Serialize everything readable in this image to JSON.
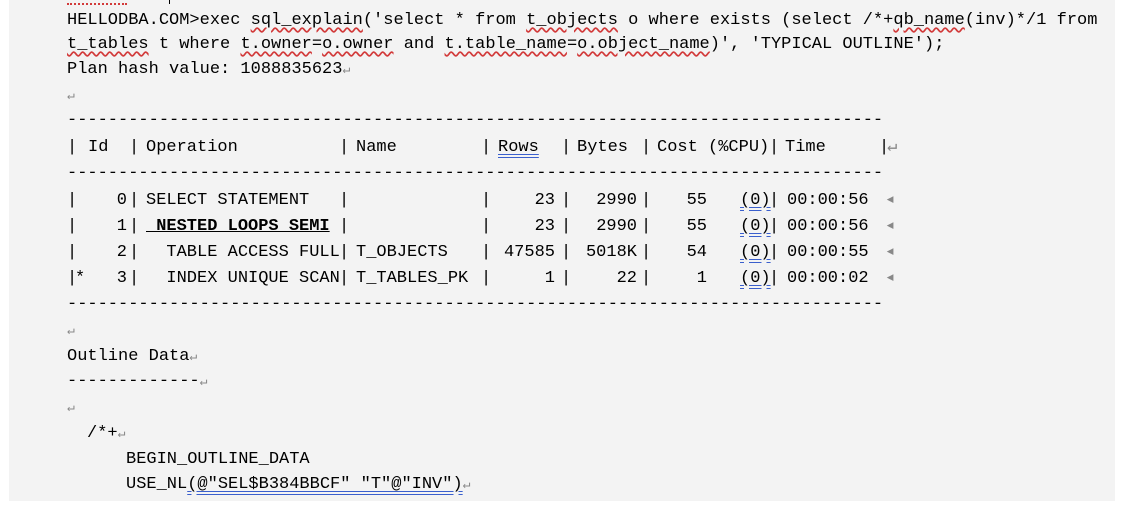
{
  "command": {
    "prompt": "HELLODBA.COM>",
    "line1_pre": "exec ",
    "line1_fn": "sql_explain",
    "line1_open": "('select * from ",
    "line1_obj": "t_objects",
    "line1_mid": " o where exists (select /*+",
    "line1_qb": "qb_name",
    "line1_end": "(inv)*/1 from",
    "line2_tbl": "t_tables",
    "line2_mid": " t where ",
    "line2_own": "t.owner",
    "line2_eq": "=",
    "line2_oown": "o.owner",
    "line2_and": " and ",
    "line2_tn": "t.table_name",
    "line2_eq2": "=",
    "line2_on": "o.object_name",
    "line2_end": ")', 'TYPICAL OUTLINE');"
  },
  "plan_hash": "Plan hash value: 1088835623",
  "dash_line": "--------------------------------------------------------------------------------",
  "headers": {
    "id": "Id",
    "operation": "Operation",
    "name": "Name",
    "rows": "Rows",
    "bytes": "Bytes",
    "cost": "Cost (%CPU)",
    "time": "Time"
  },
  "plan_rows": [
    {
      "prefix": "",
      "id": "0",
      "operation": "SELECT STATEMENT",
      "name": "",
      "rows": "23",
      "bytes": "2990",
      "cost": "55",
      "cpu": "(0)",
      "time": "00:00:56",
      "bold": false
    },
    {
      "prefix": "",
      "id": "1",
      "operation": " NESTED LOOPS SEMI",
      "name": "",
      "rows": "23",
      "bytes": "2990",
      "cost": "55",
      "cpu": "(0)",
      "time": "00:00:56",
      "bold": true
    },
    {
      "prefix": "",
      "id": "2",
      "operation": "  TABLE ACCESS FULL",
      "name": "T_OBJECTS",
      "rows": "47585",
      "bytes": "5018K",
      "cost": "54",
      "cpu": "(0)",
      "time": "00:00:55",
      "bold": false
    },
    {
      "prefix": "*",
      "id": "3",
      "operation": "  INDEX UNIQUE SCAN",
      "name": "T_TABLES_PK",
      "rows": "1",
      "bytes": "22",
      "cost": "1",
      "cpu": "(0)",
      "time": "00:00:02",
      "bold": false
    }
  ],
  "outline": {
    "title": "Outline Data",
    "underline": "-------------",
    "hint_open": "/*+",
    "begin": "BEGIN_OUTLINE_DATA",
    "use_nl_fn": "USE_NL",
    "use_nl_args": "(@\"SEL$B384BBCF\" \"T\"@\"INV\")"
  },
  "marks": {
    "return": "↵",
    "pipe": "|",
    "arrow": "◂"
  }
}
